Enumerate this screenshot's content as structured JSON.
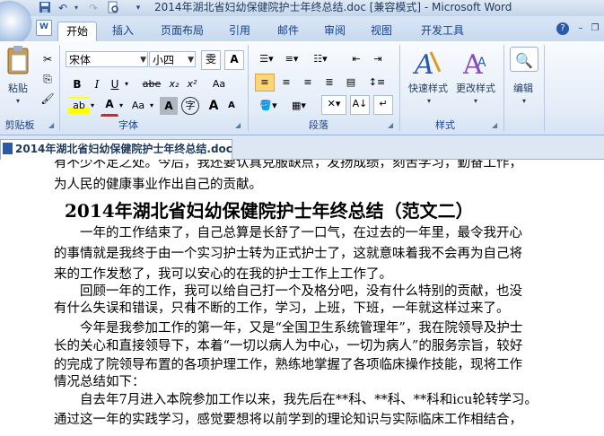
{
  "window": {
    "title": "2014年湖北省妇幼保健院护士年终总结.doc [兼容模式] - Microsoft Word"
  },
  "qat": {
    "save_icon": "save-icon",
    "undo_icon": "undo-icon",
    "redo_icon": "redo-icon",
    "print_preview_icon": "print-preview-icon",
    "customize_icon": "customize-qat-icon"
  },
  "tabs": [
    {
      "label": "开始",
      "active": true
    },
    {
      "label": "插入"
    },
    {
      "label": "页面布局"
    },
    {
      "label": "引用"
    },
    {
      "label": "邮件"
    },
    {
      "label": "审阅"
    },
    {
      "label": "视图"
    },
    {
      "label": "开发工具"
    }
  ],
  "ribbon": {
    "clipboard": {
      "paste_label": "粘贴",
      "group_label": "剪贴板"
    },
    "font": {
      "font_name": "宋体",
      "font_size": "小四",
      "wen_glyph": "雯",
      "a_glyph": "A",
      "bold": "B",
      "italic": "I",
      "underline": "U",
      "strike": "abe",
      "subscript": "x₂",
      "superscript": "x²",
      "clear_format": "Aa",
      "highlight": "ab",
      "font_color": "A",
      "change_case": "Aa",
      "char_shade": "A",
      "enclose": "字",
      "grow": "A",
      "shrink": "A",
      "group_label": "字体"
    },
    "paragraph": {
      "group_label": "段落"
    },
    "styles": {
      "quick_styles": "快速样式",
      "change_styles": "更改样式",
      "group_label": "样式"
    },
    "editing": {
      "label": "编辑"
    },
    "accent": "#15428b"
  },
  "document_tab": {
    "label": "2014年湖北省妇幼保健院护士年终总结.doc"
  },
  "document": {
    "lines": [
      "有不少不足之处。今后，我还要认真克服缺点，发扬成绩，刻苦学习，勤奋工作，",
      "为人民的健康事业作出自己的贡献。",
      "",
      "　　一年的工作结束了，自己总算是长舒了一口气，在过去的一年里，最令我开心",
      "的事情就是我终于由一个实习护士转为正式护士了，这就意味着我不会再为自己将",
      "来的工作发愁了，我可以安心的在我的护士工作上工作了。",
      "　　回顾一年的工作，我可以给自己打一个及格分吧，没有什么特别的贡献，也没",
      "有什么失误和错误，只有不断的工作，学习，上班，下班，一年就这样过来了。",
      "　　今年是我参加工作的第一年，又是“全国卫生系统管理年”，我在院领导及护士",
      "长的关心和直接领导下，本着“一切以病人为中心，一切为病人”的服务宗旨，较好",
      "的完成了院领导布置的各项护理工作，熟练地掌握了各项临床操作技能，现将工作",
      "情况总结如下：",
      "　　自去年7月进入本院参加工作以来，我先后在**科、**科、**科和icu轮转学习。",
      "通过这一年的实践学习，感觉要想将以前学到的理论知识与实际临床工作相结合，"
    ],
    "heading": "2014年湖北省妇幼保健院护士年终总结（范文二）"
  }
}
